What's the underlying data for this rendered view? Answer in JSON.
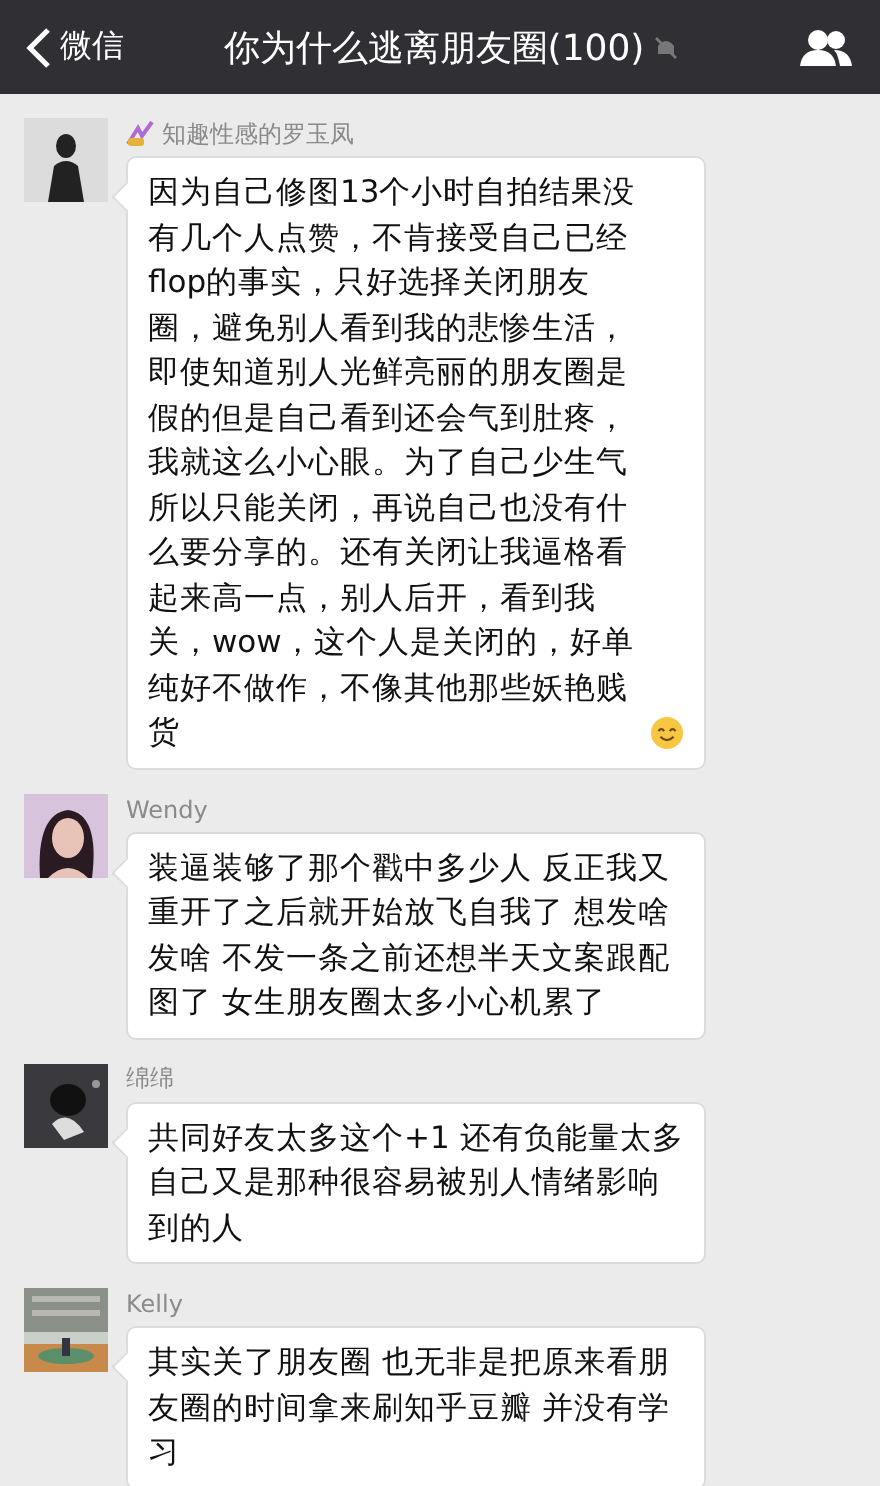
{
  "header": {
    "back_label": "微信",
    "title": "你为什么逃离朋友圈(100)",
    "muted": true
  },
  "messages": [
    {
      "sender": "知趣性感的罗玉凤",
      "sender_badge": true,
      "text": "因为自己修图13个小时自拍结果没有几个人点赞，不肯接受自己已经flop的事实，只好选择关闭朋友圈，避免别人看到我的悲惨生活，即使知道别人光鲜亮丽的朋友圈是假的但是自己看到还会气到肚疼，我就这么小心眼。为了自己少生气所以只能关闭，再说自己也没有什么要分享的。还有关闭让我逼格看起来高一点，别人后开，看到我关，wow，这个人是关闭的，好单纯好不做作，不像其他那些妖艳贱货",
      "emoji": true
    },
    {
      "sender": "Wendy",
      "sender_badge": false,
      "text": "装逼装够了那个戳中多少人 反正我又重开了之后就开始放飞自我了 想发啥发啥 不发一条之前还想半天文案跟配图了 女生朋友圈太多小心机累了",
      "emoji": false
    },
    {
      "sender": "绵绵",
      "sender_badge": false,
      "text": "共同好友太多这个+1 还有负能量太多自己又是那种很容易被别人情绪影响到的人",
      "emoji": false
    },
    {
      "sender": "Kelly",
      "sender_badge": false,
      "text": "其实关了朋友圈 也无非是把原来看朋友圈的时间拿来刷知乎豆瓣 并没有学习",
      "emoji": false
    }
  ]
}
